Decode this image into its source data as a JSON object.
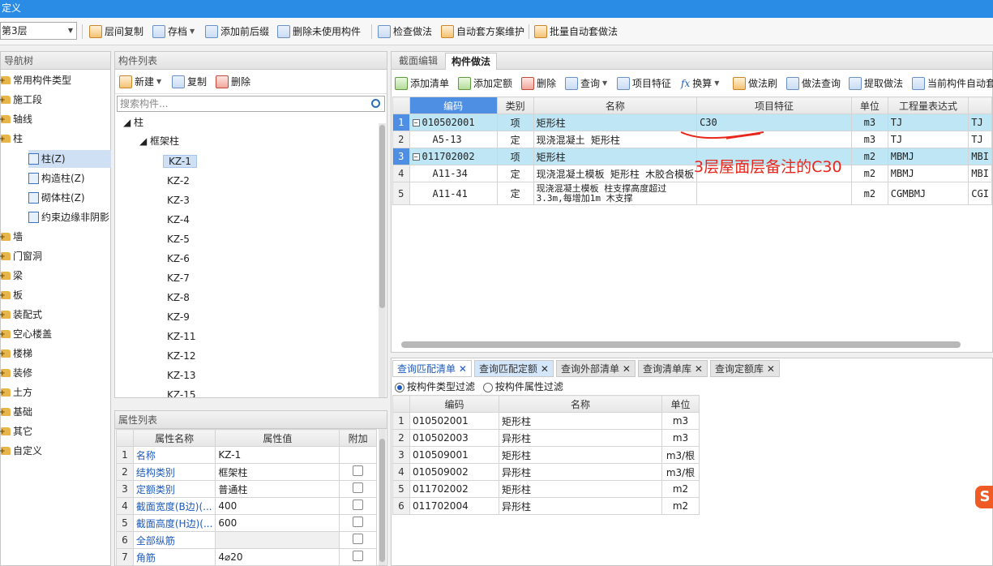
{
  "window": {
    "title": "定义"
  },
  "toolbar": {
    "floor": "第3层",
    "buttons": [
      "层间复制",
      "存档",
      "添加前后缀",
      "删除未使用构件",
      "检查做法",
      "自动套方案维护",
      "批量自动套做法"
    ]
  },
  "nav": {
    "title": "导航树",
    "items": [
      "常用构件类型",
      "施工段",
      "轴线",
      "柱",
      "墙",
      "门窗洞",
      "梁",
      "板",
      "装配式",
      "空心楼盖",
      "楼梯",
      "装修",
      "土方",
      "基础",
      "其它",
      "自定义"
    ],
    "sub": [
      "柱(Z)",
      "构造柱(Z)",
      "砌体柱(Z)",
      "约束边缘非阴影"
    ]
  },
  "comp": {
    "title": "构件列表",
    "new": "新建",
    "copy": "复制",
    "delete": "删除",
    "search_placeholder": "搜索构件...",
    "root": "柱",
    "group": "框架柱",
    "items": [
      "KZ-1",
      "KZ-2",
      "KZ-3",
      "KZ-4",
      "KZ-5",
      "KZ-6",
      "KZ-7",
      "KZ-8",
      "KZ-9",
      "KZ-11",
      "KZ-12",
      "KZ-13",
      "KZ-15"
    ]
  },
  "attr": {
    "title": "属性列表",
    "headers": [
      "属性名称",
      "属性值",
      "附加"
    ],
    "rows": [
      {
        "n": "1",
        "name": "名称",
        "value": "KZ-1"
      },
      {
        "n": "2",
        "name": "结构类别",
        "value": "框架柱"
      },
      {
        "n": "3",
        "name": "定额类别",
        "value": "普通柱"
      },
      {
        "n": "4",
        "name": "截面宽度(B边)(...",
        "value": "400"
      },
      {
        "n": "5",
        "name": "截面高度(H边)(...",
        "value": "600"
      },
      {
        "n": "6",
        "name": "全部纵筋",
        "value": ""
      },
      {
        "n": "7",
        "name": "角筋",
        "value": "4⌀20"
      }
    ]
  },
  "method": {
    "tabs": [
      "截面编辑",
      "构件做法"
    ],
    "tools": [
      "添加清单",
      "添加定额",
      "删除",
      "查询",
      "项目特征",
      "换算",
      "做法刷",
      "做法查询",
      "提取做法",
      "当前构件自动套"
    ],
    "headers": [
      "编码",
      "类别",
      "名称",
      "项目特征",
      "单位",
      "工程量表达式"
    ],
    "rows": [
      {
        "n": "1",
        "code": "010502001",
        "type": "项",
        "name": "矩形柱",
        "feature": "C30",
        "unit": "m3",
        "expr": "TJ",
        "expr2": "TJ"
      },
      {
        "n": "2",
        "code": "A5-13",
        "type": "定",
        "name": "现浇混凝土 矩形柱",
        "feature": "",
        "unit": "m3",
        "expr": "TJ",
        "expr2": "TJ"
      },
      {
        "n": "3",
        "code": "011702002",
        "type": "项",
        "name": "矩形柱",
        "feature": "",
        "unit": "m2",
        "expr": "MBMJ",
        "expr2": "MBI"
      },
      {
        "n": "4",
        "code": "A11-34",
        "type": "定",
        "name": "现浇混凝土模板 矩形柱 木胶合模板",
        "feature": "",
        "unit": "m2",
        "expr": "MBMJ",
        "expr2": "MBI"
      },
      {
        "n": "5",
        "code": "A11-41",
        "type": "定",
        "name": "现浇混凝土模板 柱支撑高度超过",
        "name2": "3.3m,每增加1m 木支撑",
        "feature": "",
        "unit": "m2",
        "expr": "CGMBMJ",
        "expr2": "CGI"
      }
    ],
    "annotation": "3层屋面层备注的C30"
  },
  "query": {
    "tabs": [
      "查询匹配清单",
      "查询匹配定额",
      "查询外部清单",
      "查询清单库",
      "查询定额库"
    ],
    "filter1": "按构件类型过滤",
    "filter2": "按构件属性过滤",
    "headers": [
      "编码",
      "名称",
      "单位"
    ],
    "rows": [
      {
        "n": "1",
        "code": "010502001",
        "name": "矩形柱",
        "unit": "m3"
      },
      {
        "n": "2",
        "code": "010502003",
        "name": "异形柱",
        "unit": "m3"
      },
      {
        "n": "3",
        "code": "010509001",
        "name": "矩形柱",
        "unit": "m3/根"
      },
      {
        "n": "4",
        "code": "010509002",
        "name": "异形柱",
        "unit": "m3/根"
      },
      {
        "n": "5",
        "code": "011702002",
        "name": "矩形柱",
        "unit": "m2"
      },
      {
        "n": "6",
        "code": "011702004",
        "name": "异形柱",
        "unit": "m2"
      }
    ]
  },
  "colors": {
    "accent": "#2b8ce6",
    "selection": "#bfe6f5",
    "annotation": "#e8261c"
  }
}
